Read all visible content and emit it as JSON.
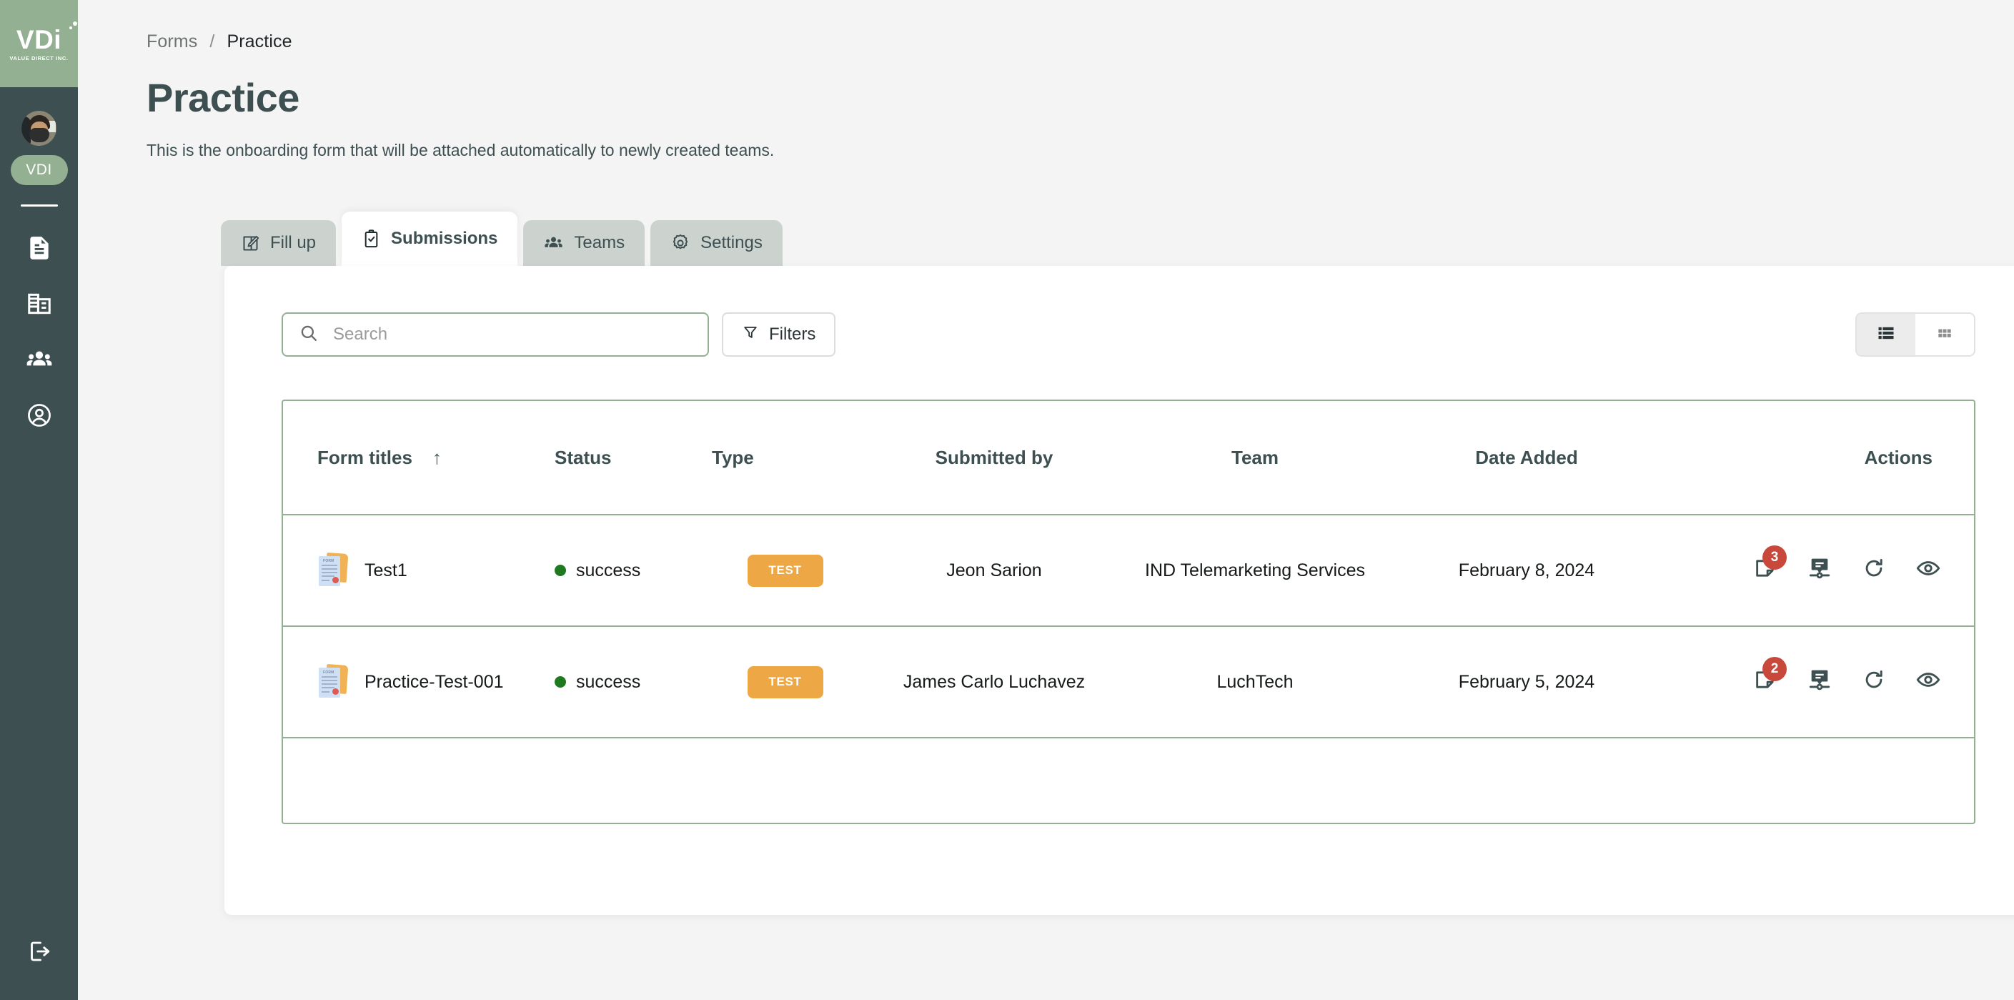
{
  "sidebar": {
    "logo": {
      "wordmark": "VDi",
      "tagline": "VALUE DIRECT INC."
    },
    "user_chip": "VDI",
    "items": [
      {
        "name": "sidebar-item-forms",
        "icon": "document-icon"
      },
      {
        "name": "sidebar-item-company",
        "icon": "building-icon"
      },
      {
        "name": "sidebar-item-teams",
        "icon": "people-icon"
      },
      {
        "name": "sidebar-item-account",
        "icon": "user-circle-icon"
      }
    ],
    "logout_icon": "logout-icon"
  },
  "breadcrumb": {
    "parent": "Forms",
    "separator": "/",
    "current": "Practice"
  },
  "page": {
    "title": "Practice",
    "subtitle": "This is the onboarding form that will be attached automatically to newly created teams."
  },
  "tabs": [
    {
      "label": "Fill up",
      "icon": "pencil-square-icon",
      "active": false
    },
    {
      "label": "Submissions",
      "icon": "clipboard-check-icon",
      "active": true
    },
    {
      "label": "Teams",
      "icon": "people-icon",
      "active": false
    },
    {
      "label": "Settings",
      "icon": "gear-icon",
      "active": false
    }
  ],
  "toolbar": {
    "search_placeholder": "Search",
    "search_value": "",
    "filters_label": "Filters",
    "view_list_icon": "list-view-icon",
    "view_grid_icon": "grid-view-icon",
    "active_view": "list"
  },
  "table": {
    "columns": [
      "Form titles",
      "Status",
      "Type",
      "Submitted by",
      "Team",
      "Date Added",
      "Actions"
    ],
    "sort_column": "Form titles",
    "sort_direction": "↑",
    "rows": [
      {
        "title": "Test1",
        "icon": "form-document-icon",
        "status": "success",
        "status_color": "#1f7a1f",
        "type": "TEST",
        "submitted_by": "Jeon Sarion",
        "team": "IND Telemarketing Services",
        "date_added": "February 8, 2024",
        "actions": {
          "notes_count": "3",
          "notes_icon": "sticky-note-icon",
          "timeline_icon": "comment-timeline-icon",
          "refresh_icon": "refresh-icon",
          "view_icon": "eye-icon"
        }
      },
      {
        "title": "Practice-Test-001",
        "icon": "form-document-icon",
        "status": "success",
        "status_color": "#1f7a1f",
        "type": "TEST",
        "submitted_by": "James Carlo Luchavez",
        "team": "LuchTech",
        "date_added": "February 5, 2024",
        "actions": {
          "notes_count": "2",
          "notes_icon": "sticky-note-icon",
          "timeline_icon": "comment-timeline-icon",
          "refresh_icon": "refresh-icon",
          "view_icon": "eye-icon"
        }
      }
    ]
  },
  "colors": {
    "sidebar_bg": "#3d4f51",
    "brand_green": "#93b093",
    "accent_orange": "#eda845",
    "badge_red": "#c8483c",
    "page_bg": "#f4f4f4"
  }
}
